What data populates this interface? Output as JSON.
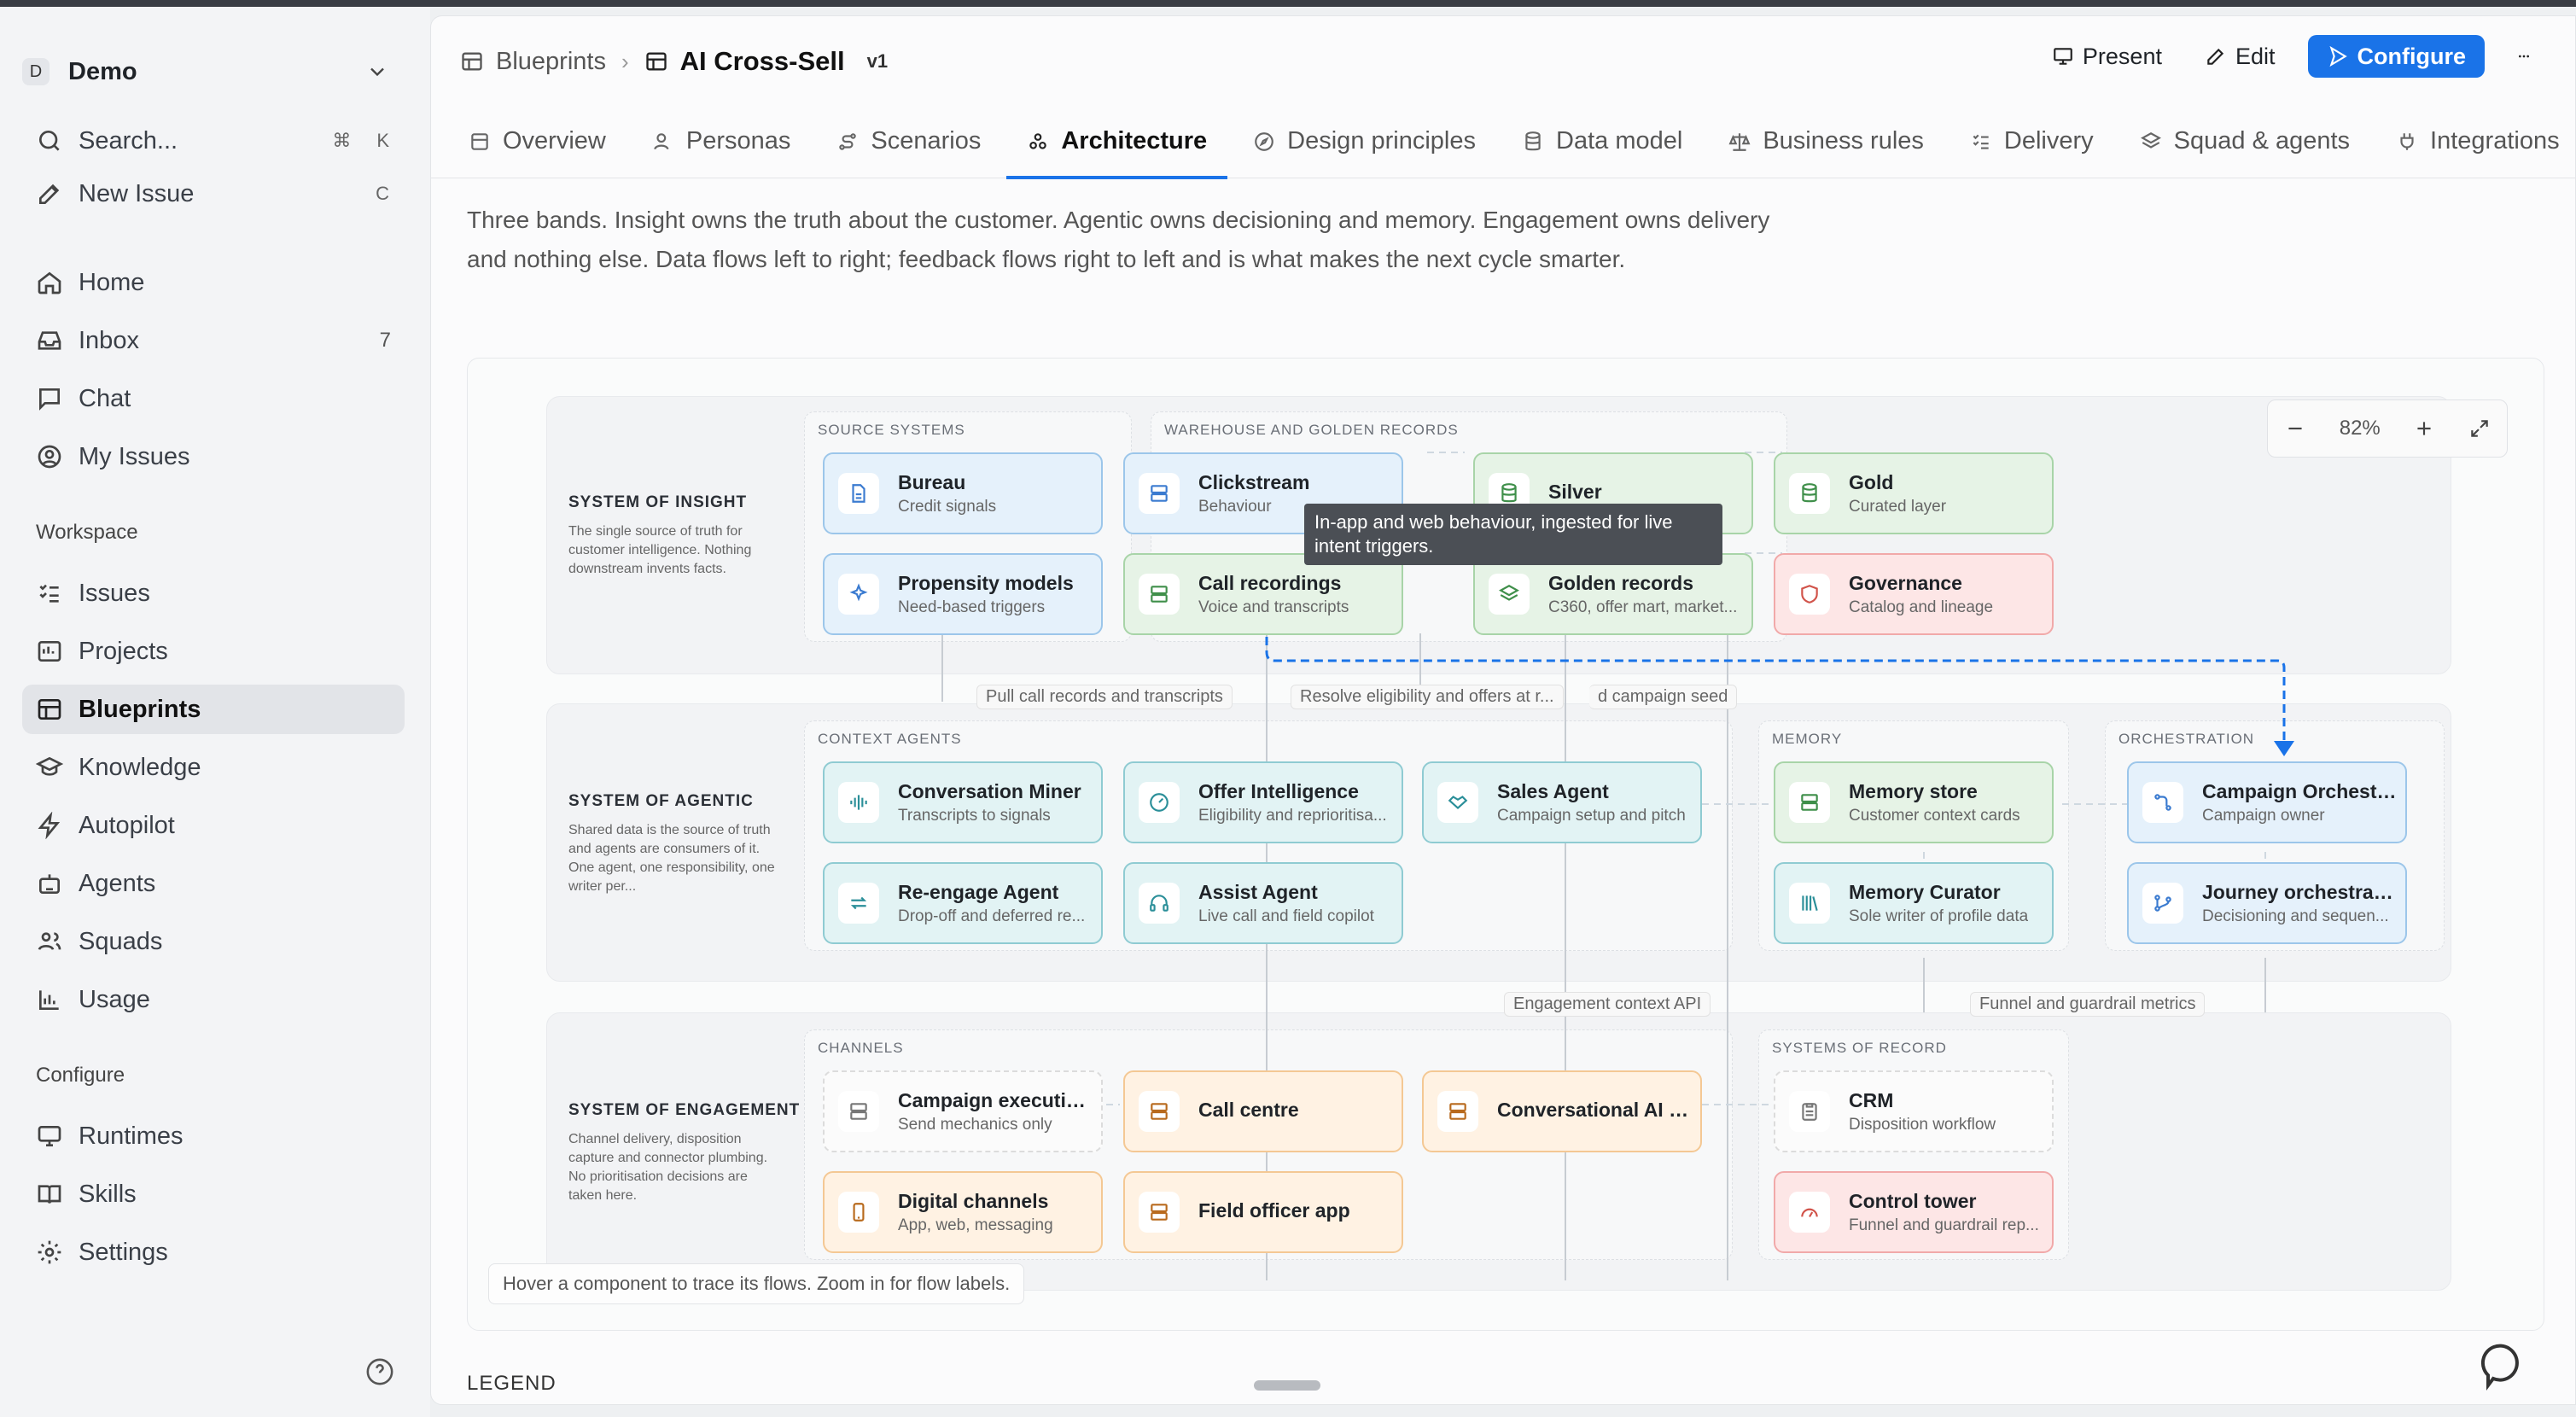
{
  "workspace": {
    "badge": "D",
    "name": "Demo"
  },
  "sidebar": {
    "search": {
      "label": "Search...",
      "shortcut1": "⌘",
      "shortcut2": "K"
    },
    "new_issue": {
      "label": "New Issue",
      "shortcut": "C"
    },
    "primary": [
      {
        "label": "Home",
        "icon": "home-icon"
      },
      {
        "label": "Inbox",
        "icon": "inbox-icon",
        "count": "7"
      },
      {
        "label": "Chat",
        "icon": "chat-icon"
      },
      {
        "label": "My Issues",
        "icon": "user-circle-icon"
      }
    ],
    "workspace_label": "Workspace",
    "workspace_items": [
      {
        "label": "Issues",
        "icon": "list-icon"
      },
      {
        "label": "Projects",
        "icon": "projects-icon"
      },
      {
        "label": "Blueprints",
        "icon": "blueprint-icon",
        "active": true
      },
      {
        "label": "Knowledge",
        "icon": "graduation-icon"
      },
      {
        "label": "Autopilot",
        "icon": "bolt-icon"
      },
      {
        "label": "Agents",
        "icon": "robot-icon"
      },
      {
        "label": "Squads",
        "icon": "users-icon"
      },
      {
        "label": "Usage",
        "icon": "bar-chart-icon"
      }
    ],
    "configure_label": "Configure",
    "configure_items": [
      {
        "label": "Runtimes",
        "icon": "monitor-icon"
      },
      {
        "label": "Skills",
        "icon": "book-icon"
      },
      {
        "label": "Settings",
        "icon": "gear-icon"
      }
    ]
  },
  "header": {
    "breadcrumb_root": "Blueprints",
    "breadcrumb_current": "AI Cross-Sell",
    "version": "v1",
    "present_label": "Present",
    "edit_label": "Edit",
    "configure_label": "Configure"
  },
  "tabs": [
    {
      "label": "Overview"
    },
    {
      "label": "Personas"
    },
    {
      "label": "Scenarios"
    },
    {
      "label": "Architecture",
      "active": true
    },
    {
      "label": "Design principles"
    },
    {
      "label": "Data model"
    },
    {
      "label": "Business rules"
    },
    {
      "label": "Delivery"
    },
    {
      "label": "Squad & agents"
    },
    {
      "label": "Integrations"
    }
  ],
  "intro": "Three bands. Insight owns the truth about the customer. Agentic owns decisioning and memory. Engagement owns delivery and nothing else. Data flows left to right; feedback flows right to left and is what makes the next cycle smarter.",
  "diagram": {
    "zoom": "82%",
    "bands": [
      {
        "title": "SYSTEM OF INSIGHT",
        "desc": "The single source of truth for customer intelligence. Nothing downstream invents facts."
      },
      {
        "title": "SYSTEM OF AGENTIC",
        "desc": "Shared data is the source of truth and agents are consumers of it. One agent, one responsibility, one writer per..."
      },
      {
        "title": "SYSTEM OF ENGAGEMENT",
        "desc": "Channel delivery, disposition capture and connector plumbing. No prioritisation decisions are taken here."
      }
    ],
    "groups": {
      "source_systems": "SOURCE SYSTEMS",
      "warehouse": "WAREHOUSE AND GOLDEN RECORDS",
      "context_agents": "CONTEXT AGENTS",
      "memory": "MEMORY",
      "orchestration": "ORCHESTRATION",
      "channels": "CHANNELS",
      "systems_of_record": "SYSTEMS OF RECORD"
    },
    "nodes": {
      "bureau": {
        "title": "Bureau",
        "sub": "Credit signals"
      },
      "clickstream": {
        "title": "Clickstream",
        "sub": "Behaviour"
      },
      "silver": {
        "title": "Silver",
        "sub": ""
      },
      "gold": {
        "title": "Gold",
        "sub": "Curated layer"
      },
      "propensity": {
        "title": "Propensity models",
        "sub": "Need-based triggers"
      },
      "call_recordings": {
        "title": "Call recordings",
        "sub": "Voice and transcripts"
      },
      "golden_records": {
        "title": "Golden records",
        "sub": "C360, offer mart, market..."
      },
      "governance": {
        "title": "Governance",
        "sub": "Catalog and lineage"
      },
      "conversation_miner": {
        "title": "Conversation Miner",
        "sub": "Transcripts to signals"
      },
      "offer_intelligence": {
        "title": "Offer Intelligence",
        "sub": "Eligibility and reprioritisa..."
      },
      "sales_agent": {
        "title": "Sales Agent",
        "sub": "Campaign setup and pitch"
      },
      "memory_store": {
        "title": "Memory store",
        "sub": "Customer context cards"
      },
      "campaign_orchestrator": {
        "title": "Campaign Orchestra...",
        "sub": "Campaign owner"
      },
      "reengage_agent": {
        "title": "Re-engage Agent",
        "sub": "Drop-off and deferred re..."
      },
      "assist_agent": {
        "title": "Assist Agent",
        "sub": "Live call and field copilot"
      },
      "memory_curator": {
        "title": "Memory Curator",
        "sub": "Sole writer of profile data"
      },
      "journey_orchestration": {
        "title": "Journey orchestration",
        "sub": "Decisioning and sequen..."
      },
      "campaign_execution": {
        "title": "Campaign execution...",
        "sub": "Send mechanics only"
      },
      "call_centre": {
        "title": "Call centre",
        "sub": ""
      },
      "conversational_bot": {
        "title": "Conversational AI bot",
        "sub": ""
      },
      "crm": {
        "title": "CRM",
        "sub": "Disposition workflow"
      },
      "digital_channels": {
        "title": "Digital channels",
        "sub": "App, web, messaging"
      },
      "field_officer": {
        "title": "Field officer app",
        "sub": ""
      },
      "control_tower": {
        "title": "Control tower",
        "sub": "Funnel and guardrail rep..."
      }
    },
    "flow_labels": {
      "pull_calls": "Pull call records and transcripts",
      "resolve_eligibility": "Resolve eligibility and offers at r...",
      "campaign_seed": "d campaign seed",
      "engagement_api": "Engagement context API",
      "funnel_metrics": "Funnel and guardrail metrics"
    },
    "tooltip": "In-app and web behaviour, ingested for live intent triggers.",
    "hint": "Hover a component to trace its flows. Zoom in for flow labels."
  },
  "legend_label": "LEGEND",
  "colors": {
    "accent": "#1a73e8",
    "flow_highlight": "#1a73e8"
  }
}
